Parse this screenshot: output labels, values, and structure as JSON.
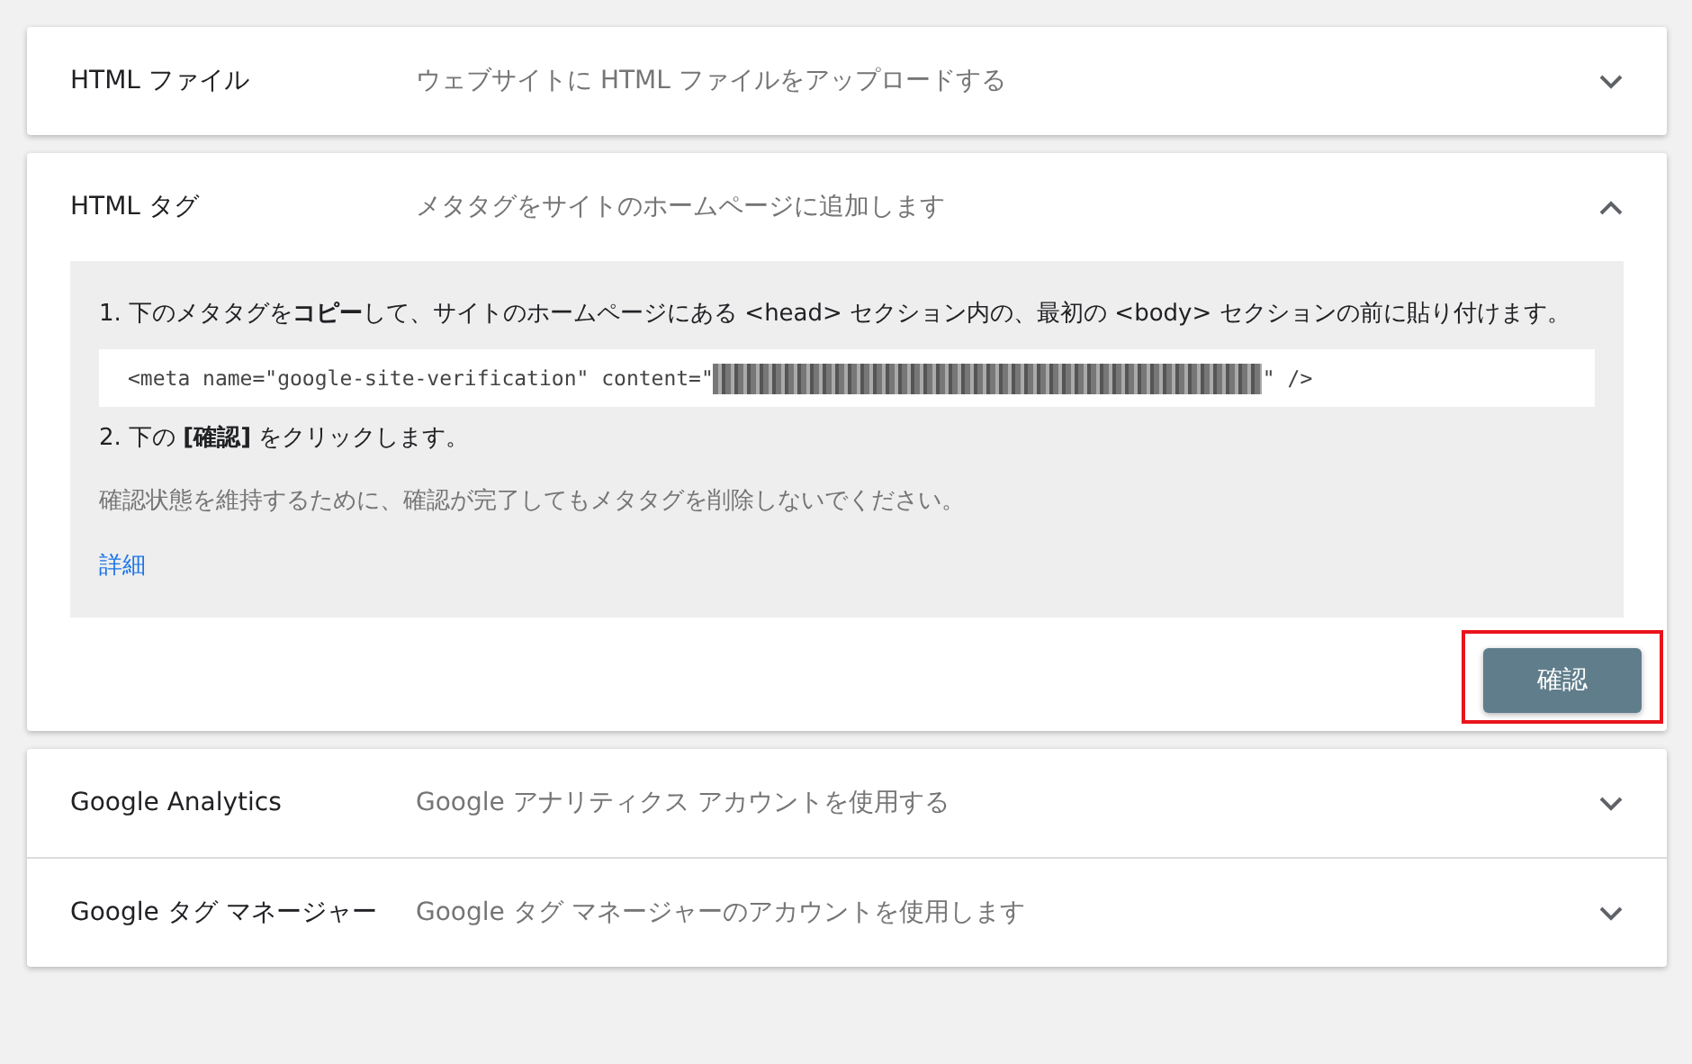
{
  "methods": [
    {
      "title": "HTML ファイル",
      "description": "ウェブサイトに HTML ファイルをアップロードする",
      "expanded": false
    },
    {
      "title": "HTML タグ",
      "description": "メタタグをサイトのホームページに追加します",
      "expanded": true,
      "body": {
        "step_1": "1. 下のメタタグを**コピー**して、サイトのホームページにある <head> セクション内の、最初の <body> セクションの前に貼り付けます。",
        "code_start": "<meta name=\"google-site-verification\" content=\"",
        "code_end": "\" />",
        "step_2": "2. 下の **[確認]** をクリックします。",
        "note": "確認状態を維持するために、確認が完了してもメタタグを削除しないでください。",
        "link": "詳細",
        "button": "確認",
        "button_highlighted": true
      }
    }
  ],
  "other_methods": [
    {
      "title": "Google Analytics",
      "description": "Google アナリティクス アカウントを使用する",
      "expanded": false
    },
    {
      "title": "Google タグ マネージャー",
      "description": "Google タグ マネージャーのアカウントを使用します",
      "expanded": false
    }
  ]
}
